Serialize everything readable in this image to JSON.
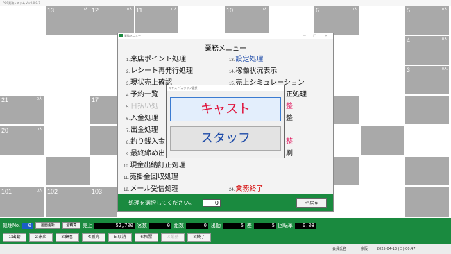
{
  "app": {
    "title": "POS業務システム  Ver9.0.0.7"
  },
  "tiles": [
    {
      "num": "13",
      "count": "0人",
      "sub": ""
    },
    {
      "num": "12",
      "count": "0人",
      "sub": ""
    },
    {
      "num": "11",
      "count": "0人",
      "sub": ""
    },
    {
      "num": "10",
      "count": "0人",
      "sub": ""
    },
    {
      "num": "6",
      "count": "0人",
      "sub": ""
    },
    {
      "num": "5",
      "count": "0人",
      "sub": ""
    },
    {
      "num": "4",
      "count": "0人",
      "sub": ""
    },
    {
      "num": "3",
      "count": "0人",
      "sub": ""
    },
    {
      "num": "21",
      "count": "0人",
      "sub": ""
    },
    {
      "num": "17",
      "count": "",
      "sub": ""
    },
    {
      "num": "20",
      "count": "0人",
      "sub": ""
    },
    {
      "num": "101",
      "count": "0人",
      "sub": ""
    },
    {
      "num": "102",
      "count": "",
      "sub": ""
    },
    {
      "num": "103",
      "count": "",
      "sub": ""
    }
  ],
  "menu_window": {
    "title": "業務メニュー",
    "heading": "業務メニュー",
    "left_items": [
      {
        "num": "1.",
        "label": "来店ポイント処理"
      },
      {
        "num": "2.",
        "label": "レシート再発行処理"
      },
      {
        "num": "3.",
        "label": "現状売上確認"
      },
      {
        "num": "4.",
        "label": "予約一覧"
      },
      {
        "num": "5.",
        "label": "日払い処"
      },
      {
        "num": "6.",
        "label": "入金処理"
      },
      {
        "num": "7.",
        "label": "出金処理"
      },
      {
        "num": "8.",
        "label": "釣り銭入金"
      },
      {
        "num": "9.",
        "label": "最終締め出"
      },
      {
        "num": "10.",
        "label": "現金出納訂正処理"
      },
      {
        "num": "11.",
        "label": "売掛金回収処理"
      },
      {
        "num": "12.",
        "label": "メール受信処理"
      }
    ],
    "right_items": [
      {
        "num": "13.",
        "label": "設定処理"
      },
      {
        "num": "14.",
        "label": "稼働状況表示"
      },
      {
        "num": "15.",
        "label": "売上シミュレーション"
      },
      {
        "num": "",
        "label": "正処理"
      },
      {
        "num": "",
        "label": "整"
      },
      {
        "num": "",
        "label": "整"
      },
      {
        "num": "",
        "label": "整"
      },
      {
        "num": "",
        "label": "刷"
      },
      {
        "num": "24.",
        "label": "業務終了"
      }
    ],
    "prompt": "処理を選択してください。",
    "prompt_value": "0",
    "back_label": "戻る"
  },
  "popup": {
    "title": "キャスト/スタッフ選択",
    "cast_label": "キャスト",
    "staff_label": "スタッフ"
  },
  "bottom": {
    "shori_label": "処理No.",
    "shori_value": "0",
    "btn_screen": "画面更新",
    "btn_kinseisan": "全精算",
    "uriage_label": "売上",
    "uriage_value": "52,700",
    "kyakusu_label": "客数",
    "kyakusu_value": "0",
    "kumisu_label": "組数",
    "kumisu_value": "0",
    "shukkin_label": "出勤",
    "shukkin_value": "5",
    "sa_label": "差",
    "sa_value": "5",
    "kaiten_label": "回転率",
    "kaiten_value": "0.08"
  },
  "fkeys": [
    "1:出勤",
    "2:来店",
    "3:顧客",
    "4:販売",
    "5:取消",
    "6:帳票",
    "7:",
    ":8:終了"
  ],
  "fkeys_clean": [
    "1:出勤",
    "2:来店",
    "3:顧客",
    "4:販売",
    "5:取消",
    "6:帳票",
    "7:業務",
    "8:終了"
  ],
  "status": {
    "user": "会員氏名",
    "store": "京阪",
    "datetime": "2025-04-13 (日) 00:47"
  },
  "colors": {
    "accent_green": "#1a8a3f",
    "tile": "#a9a9a9",
    "cast_red": "#e0143c",
    "staff_blue": "#1c4aa8"
  }
}
